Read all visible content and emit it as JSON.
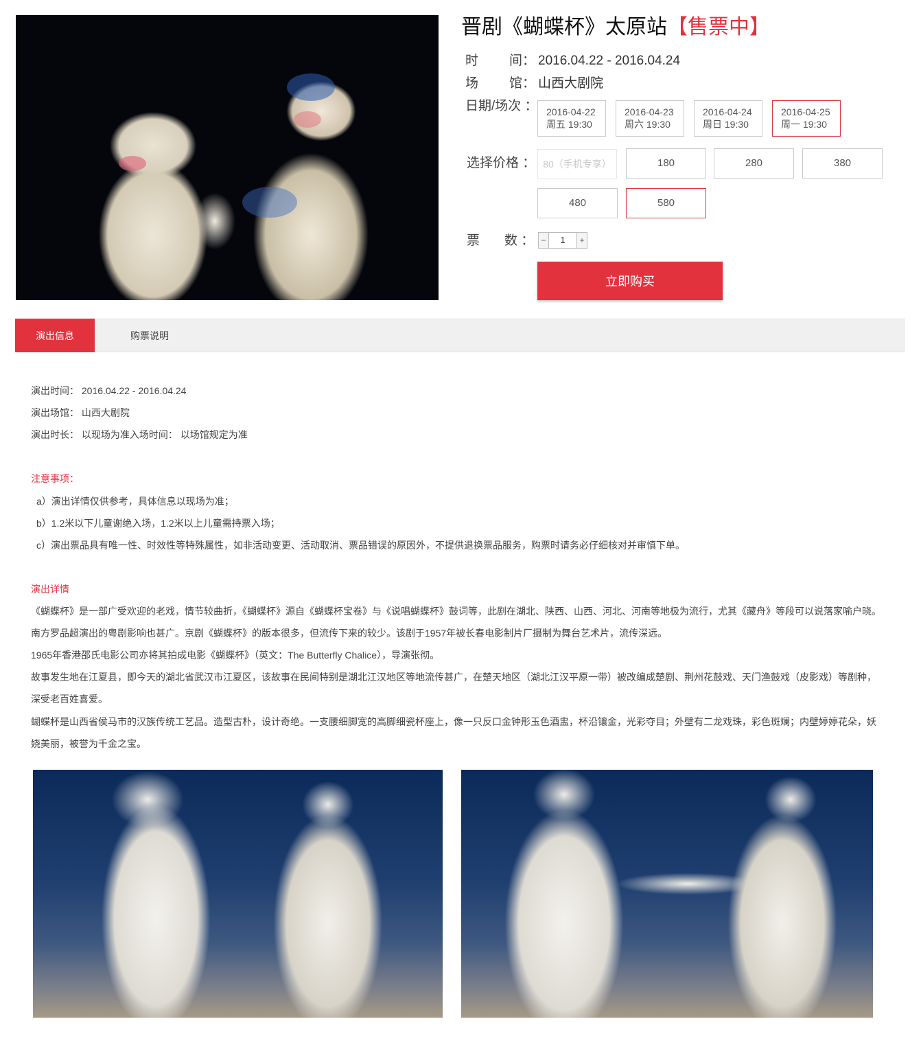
{
  "product": {
    "title": "晋剧《蝴蝶杯》太原站",
    "status": "【售票中】",
    "time_label_a": "时",
    "time_label_b": "间：",
    "time_value": "2016.04.22 - 2016.04.24",
    "venue_label_a": "场",
    "venue_label_b": "馆：",
    "venue_value": "山西大剧院",
    "session_label": "日期/场次 ：",
    "sessions": [
      {
        "date": "2016-04-22",
        "time": "周五 19:30"
      },
      {
        "date": "2016-04-23",
        "time": "周六 19:30"
      },
      {
        "date": "2016-04-24",
        "time": "周日 19:30"
      },
      {
        "date": "2016-04-25",
        "time": "周一 19:30"
      }
    ],
    "price_label": "选择价格 ：",
    "prices": [
      "80（手机专享）",
      "180",
      "280",
      "380",
      "480",
      "580"
    ],
    "qty_label_a": "票",
    "qty_label_b": "数 ：",
    "qty_minus": "−",
    "qty_value": "1",
    "qty_plus": "+",
    "buy_label": "立即购买"
  },
  "tabs": [
    "演出信息",
    "购票说明"
  ],
  "info": {
    "time": "演出时间： 2016.04.22 - 2016.04.24",
    "venue": "演出场馆： 山西大剧院",
    "duration": "演出时长： 以现场为准入场时间： 以场馆规定为准"
  },
  "notice": {
    "heading": "注意事项：",
    "items": [
      "a）演出详情仅供参考，具体信息以现场为准；",
      "b）1.2米以下儿童谢绝入场，1.2米以上儿童需持票入场；",
      "c）演出票品具有唯一性、时效性等特殊属性，如非活动变更、活动取消、票品错误的原因外，不提供退换票品服务，购票时请务必仔细核对并审慎下单。"
    ]
  },
  "details": {
    "heading": "演出详情",
    "paragraphs": [
      "《蝴蝶杯》是一部广受欢迎的老戏，情节较曲折，《蝴蝶杯》源自《蝴蝶杯宝卷》与《说唱蝴蝶杯》鼓词等，此剧在湖北、陕西、山西、河北、河南等地极为流行，尤其《藏舟》等段可以说落家喻户晓。南方罗品超演出的粤剧影响也甚广。京剧《蝴蝶杯》的版本很多，但流传下来的较少。该剧于1957年被长春电影制片厂摄制为舞台艺术片，流传深远。",
      "1965年香港邵氏电影公司亦将其拍成电影《蝴蝶杯》（英文：The Butterfly Chalice），导演张彻。",
      "故事发生地在江夏县，即今天的湖北省武汉市江夏区，该故事在民间特别是湖北江汉地区等地流传甚广，在楚天地区（湖北江汉平原一带）被改编成楚剧、荆州花鼓戏、天门渔鼓戏（皮影戏）等剧种，深受老百姓喜爱。",
      "蝴蝶杯是山西省侯马市的汉族传统工艺品。造型古朴，设计奇绝。一支腰细脚宽的高脚细瓷杯座上，像一只反口金钟形玉色酒盅，杯沿镶金，光彩夺目；外壁有二龙戏珠，彩色斑斓；内壁婷婷花朵，妖娆美丽，被誉为千金之宝。"
    ]
  },
  "colors": {
    "accent": "#e2323e",
    "border_selected": "#d9363e",
    "tab_bg": "#f0f0f0"
  }
}
